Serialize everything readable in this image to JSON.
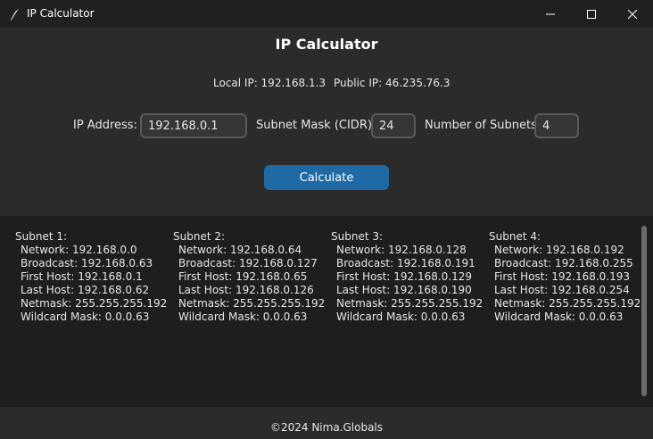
{
  "window": {
    "title": "IP Calculator"
  },
  "header": {
    "heading": "IP Calculator",
    "local_ip": "Local IP: 192.168.1.3",
    "public_ip": "Public IP: 46.235.76.3"
  },
  "form": {
    "ip_label": "IP Address:",
    "ip_value": "192.168.0.1",
    "mask_label": "Subnet Mask (CIDR):",
    "mask_value": "24",
    "subnets_label": "Number of Subnets:",
    "subnets_value": "4",
    "calculate_label": "Calculate"
  },
  "results": [
    {
      "title": "Subnet 1:",
      "network": "Network: 192.168.0.0",
      "broadcast": "Broadcast: 192.168.0.63",
      "first_host": "First Host: 192.168.0.1",
      "last_host": "Last Host: 192.168.0.62",
      "netmask": "Netmask: 255.255.255.192",
      "wildcard": "Wildcard Mask: 0.0.0.63"
    },
    {
      "title": "Subnet 2:",
      "network": "Network: 192.168.0.64",
      "broadcast": "Broadcast: 192.168.0.127",
      "first_host": "First Host: 192.168.0.65",
      "last_host": "Last Host: 192.168.0.126",
      "netmask": "Netmask: 255.255.255.192",
      "wildcard": "Wildcard Mask: 0.0.0.63"
    },
    {
      "title": "Subnet 3:",
      "network": "Network: 192.168.0.128",
      "broadcast": "Broadcast: 192.168.0.191",
      "first_host": "First Host: 192.168.0.129",
      "last_host": "Last Host: 192.168.0.190",
      "netmask": "Netmask: 255.255.255.192",
      "wildcard": "Wildcard Mask: 0.0.0.63"
    },
    {
      "title": "Subnet 4:",
      "network": "Network: 192.168.0.192",
      "broadcast": "Broadcast: 192.168.0.255",
      "first_host": "First Host: 192.168.0.193",
      "last_host": "Last Host: 192.168.0.254",
      "netmask": "Netmask: 255.255.255.192",
      "wildcard": "Wildcard Mask: 0.0.0.63"
    }
  ],
  "footer": {
    "text": "©2024 Nima.Globals"
  },
  "icons": {
    "app": "feather-icon",
    "minimize": "minimize-icon",
    "maximize": "maximize-icon",
    "close": "close-icon"
  },
  "colors": {
    "window_bg": "#2b2b2b",
    "titlebar_bg": "#202020",
    "results_bg": "#1d1e1e",
    "button_accent": "#1f6aa5",
    "entry_bg": "#343638",
    "entry_border": "#565b5e"
  }
}
